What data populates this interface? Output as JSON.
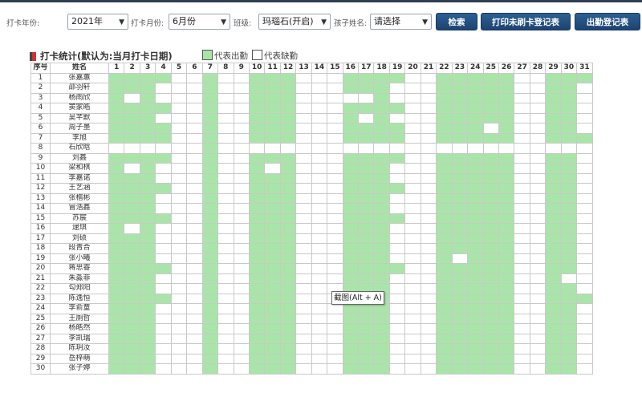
{
  "filters": {
    "year_label": "打卡年份:",
    "year_value": "2021年",
    "month_label": "打卡月份:",
    "month_value": "6月份",
    "class_label": "班级:",
    "class_value": "玛瑙石(开启)",
    "child_label": "孩子姓名:",
    "child_value": "请选择",
    "search_button": "检索",
    "print_button": "打印未刷卡登记表",
    "attendance_sheet_button": "出勤登记表"
  },
  "section": {
    "title": "打卡统计(默认为:当月打卡日期)",
    "legend_present": "代表出勤",
    "legend_absent": "代表缺勤",
    "present_color": "#a9e5a9"
  },
  "table": {
    "header_index": "序号",
    "header_name": "姓名",
    "days": [
      "1",
      "2",
      "3",
      "4",
      "5",
      "6",
      "7",
      "8",
      "9",
      "10",
      "11",
      "12",
      "13",
      "14",
      "15",
      "16",
      "17",
      "18",
      "19",
      "20",
      "21",
      "22",
      "23",
      "24",
      "25",
      "26",
      "27",
      "28",
      "29",
      "30",
      "31"
    ],
    "rows": [
      {
        "n": "1",
        "name": "张嘉蕙",
        "p": "0111100100111000111100111110011100"
      },
      {
        "n": "2",
        "name": "邵羽轩",
        "p": "0111000100111000111000111110011000"
      },
      {
        "n": "3",
        "name": "杨雨欣",
        "p": "0101000100111000001000111110011000"
      },
      {
        "n": "4",
        "name": "窦家皓",
        "p": "0111100100111000111100111110011000"
      },
      {
        "n": "5",
        "name": "吴芊默",
        "p": "0111000100111000101000111110011000"
      },
      {
        "n": "6",
        "name": "周子墨",
        "p": "0111100100111000111100111010011000"
      },
      {
        "n": "7",
        "name": "李旭",
        "p": "0111100100111000111100111110011100"
      },
      {
        "n": "8",
        "name": "石欣晗",
        "p": "0000000100000000000000000000000000"
      },
      {
        "n": "9",
        "name": "刘鑫",
        "p": "0111100100111000111100111110011000"
      },
      {
        "n": "10",
        "name": "梁和棋",
        "p": "0101000100101000111000111110011000"
      },
      {
        "n": "11",
        "name": "李嘉诺",
        "p": "0111000100111000111000111110011000"
      },
      {
        "n": "12",
        "name": "王艺涵",
        "p": "0111100100111000111100111110011000"
      },
      {
        "n": "13",
        "name": "张楷彬",
        "p": "0111000100111000111000111110011000"
      },
      {
        "n": "14",
        "name": "冒浩鑫",
        "p": "0111000100111000111000111110011000"
      },
      {
        "n": "15",
        "name": "苏宸",
        "p": "0111100100111000111100111110011000"
      },
      {
        "n": "16",
        "name": "逯琪",
        "p": "0101000100111000111000111110011000"
      },
      {
        "n": "17",
        "name": "刘硕",
        "p": "0111000100111000111000111110011000"
      },
      {
        "n": "18",
        "name": "段青合",
        "p": "0111000100111000111000111110011000"
      },
      {
        "n": "19",
        "name": "张小曦",
        "p": "0111000100111000111000101110011000"
      },
      {
        "n": "20",
        "name": "蒋思睿",
        "p": "0111100100111000111100111110011000"
      },
      {
        "n": "21",
        "name": "朱淼菲",
        "p": "0111000100111000111000111110010000"
      },
      {
        "n": "22",
        "name": "勾郑阳",
        "p": "0111000100111000111000111110011000"
      },
      {
        "n": "23",
        "name": "陈逸恒",
        "p": "0111100100111000111000111110011100"
      },
      {
        "n": "24",
        "name": "李俞童",
        "p": "0111000100111000111000111110011000"
      },
      {
        "n": "25",
        "name": "王厕哲",
        "p": "0111000100111000111000111110011000"
      },
      {
        "n": "26",
        "name": "杨皓然",
        "p": "0111000100111000111000111110011000"
      },
      {
        "n": "27",
        "name": "李凯瑞",
        "p": "0111000100111000111000111110011000"
      },
      {
        "n": "28",
        "name": "陈玥汝",
        "p": "0111000100111000111000111110011000"
      },
      {
        "n": "29",
        "name": "岳梓萌",
        "p": "0111000100111000111000111110011000"
      },
      {
        "n": "30",
        "name": "张子婷",
        "p": "0111000100111000111000111110011000"
      }
    ]
  },
  "tooltip": "截图(Alt + A)"
}
